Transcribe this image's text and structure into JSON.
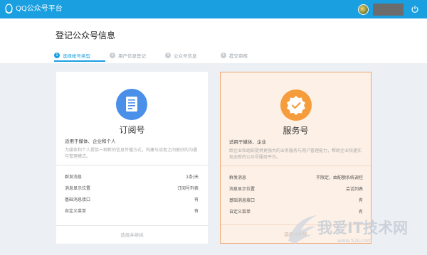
{
  "topbar": {
    "title": "QQ公众号平台",
    "logo_icon": "qq-penguin-icon",
    "power_icon": "power-icon",
    "bg_color": "#1a9fe0"
  },
  "page": {
    "title": "登记公众号信息"
  },
  "steps": [
    {
      "num": "1",
      "label": "选择帐号类型",
      "active": true
    },
    {
      "num": "2",
      "label": "用户信息登记",
      "active": false
    },
    {
      "num": "3",
      "label": "公众号信息",
      "active": false
    },
    {
      "num": "4",
      "label": "提交审核",
      "active": false
    }
  ],
  "cards": [
    {
      "icon": "document-icon",
      "title": "订阅号",
      "subtitle": "适用于媒体、企业和个人",
      "description": "为媒体和个人提供一种新的信息传播方式，构建与读者之间更好的沟通与管理模式。",
      "rows": [
        {
          "label": "群发消息",
          "value": "1条/天"
        },
        {
          "label": "消息显示位置",
          "value": "订阅号列表"
        },
        {
          "label": "基础消息接口",
          "value": "有"
        },
        {
          "label": "自定义菜单",
          "value": "有"
        }
      ],
      "button": "选择并继续"
    },
    {
      "icon": "badge-check-icon",
      "title": "服务号",
      "subtitle": "适用于媒体、企业",
      "description": "给企业和组织提供更强大的业务服务与用户管理能力，帮助企业快速实现全新的公众号服务平台。",
      "rows": [
        {
          "label": "群发消息",
          "value": "不限定，由配额系统调控"
        },
        {
          "label": "消息显示位置",
          "value": "会话列表"
        },
        {
          "label": "基础消息接口",
          "value": "有"
        },
        {
          "label": "自定义菜单",
          "value": "有"
        }
      ],
      "button": "选择并继续",
      "accent": "#f59c3c"
    }
  ],
  "watermark": {
    "text": "我爱IT技术网",
    "url": "www.52ij.com"
  }
}
